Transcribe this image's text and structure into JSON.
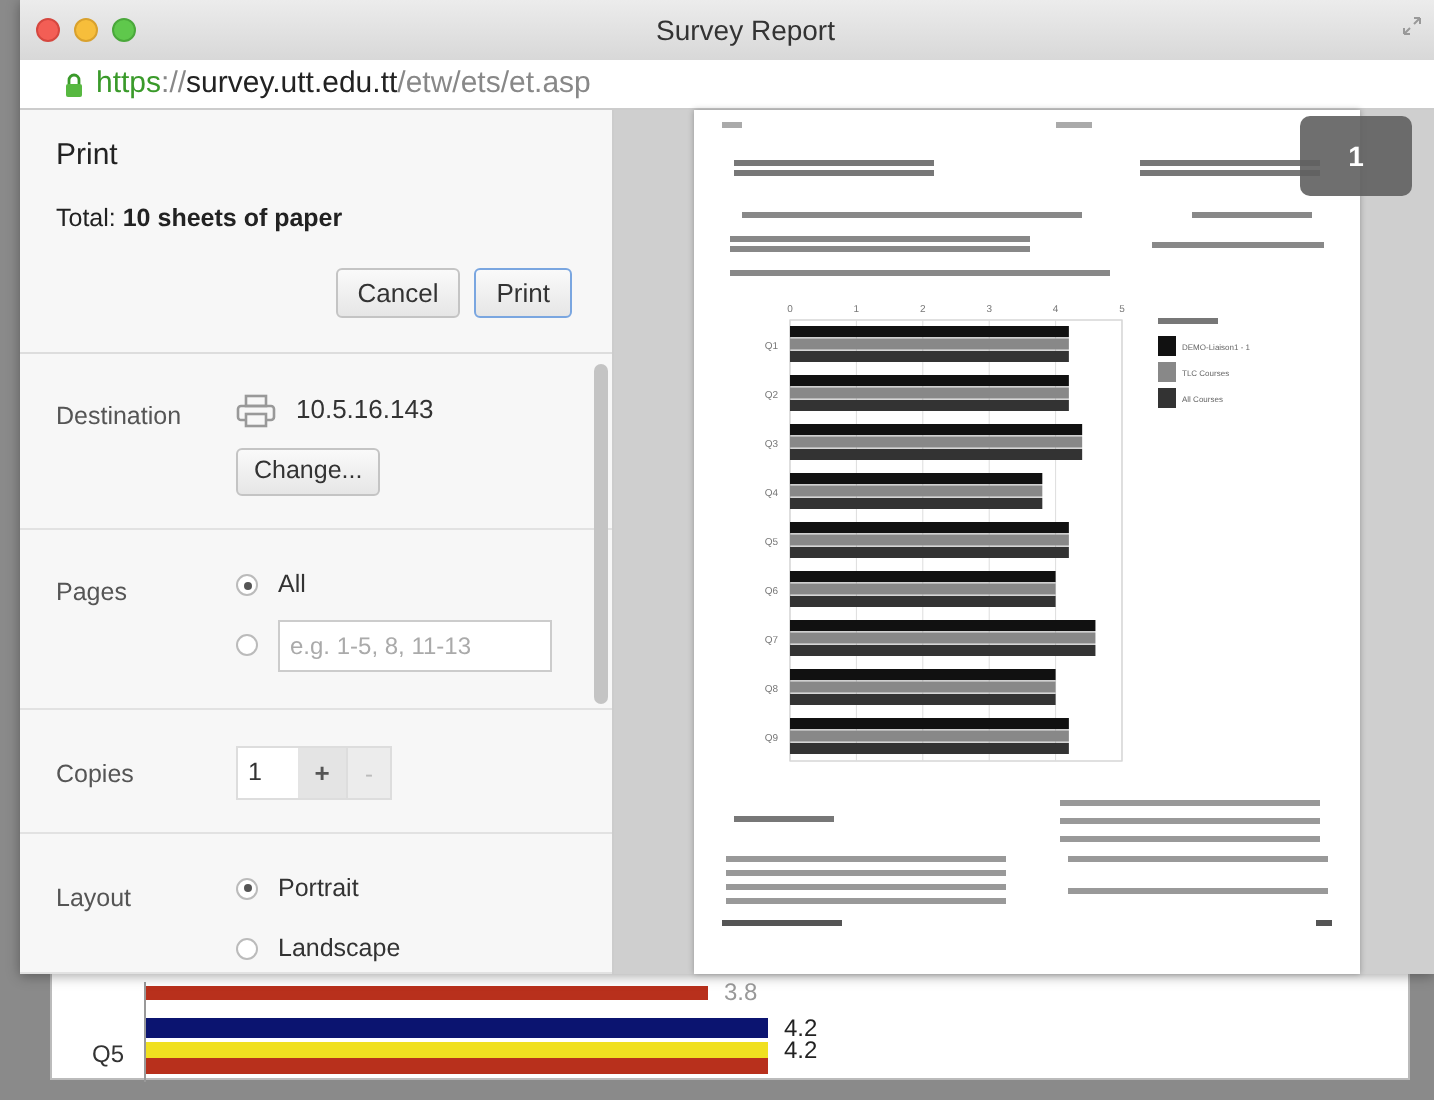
{
  "window": {
    "title": "Survey Report",
    "url": {
      "scheme": "https",
      "separator": "://",
      "host": "survey.utt.edu.tt",
      "path": "/etw/ets/et.asp"
    }
  },
  "print_panel": {
    "title": "Print",
    "total": "Total: **10 sheets of paper**",
    "buttons": [
      {
        "label": "Cancel",
        "default": false
      },
      {
        "label": "Print",
        "default": true
      }
    ]
  },
  "settings": [
    {
      "kind": "destination",
      "label": "Destination",
      "printer": "10.5.16.143",
      "button": "Change..."
    },
    {
      "kind": "pages",
      "label": "Pages",
      "options": [
        {
          "label": "All",
          "selected": true
        },
        {
          "placeholder": "e.g. 1-5, 8, 11-13",
          "selected": false
        }
      ]
    },
    {
      "kind": "copies",
      "label": "Copies",
      "value": "1",
      "increment": "+",
      "decrement": "-",
      "decrement_disabled": true
    },
    {
      "kind": "layout",
      "label": "Layout",
      "options": [
        {
          "label": "Portrait",
          "selected": true
        },
        {
          "label": "Landscape",
          "selected": false
        }
      ]
    }
  ],
  "preview": {
    "page_number": "1",
    "chart_data": {
      "type": "bar",
      "orientation": "horizontal",
      "categories": [
        "Q1",
        "Q2",
        "Q3",
        "Q4",
        "Q5",
        "Q6",
        "Q7",
        "Q8",
        "Q9"
      ],
      "xlim": [
        0,
        5
      ],
      "grid": true,
      "xticks": [
        0,
        1,
        2,
        3,
        4,
        5
      ],
      "series": [
        {
          "name": "DEMO-Liaison1 - 1",
          "color": "#111111",
          "values": [
            4.2,
            4.2,
            4.4,
            3.8,
            4.2,
            4.0,
            4.6,
            4.0,
            4.2
          ]
        },
        {
          "name": "TLC Courses",
          "color": "#888888",
          "values": [
            4.2,
            4.2,
            4.4,
            3.8,
            4.2,
            4.0,
            4.6,
            4.0,
            4.2
          ]
        },
        {
          "name": "All Courses",
          "color": "#333333",
          "values": [
            4.2,
            4.2,
            4.4,
            3.8,
            4.2,
            4.0,
            4.6,
            4.0,
            4.2
          ]
        }
      ]
    }
  },
  "background_chart": {
    "category": "Q5",
    "bars": [
      {
        "value": "3.8",
        "color": "#b8301c",
        "level": 0.76
      },
      {
        "value": "4.2",
        "color": "#0b1470",
        "level": 0.84
      },
      {
        "value": "4.2",
        "color": "#f0e020",
        "level": 0.84
      },
      {
        "color": "#b8301c",
        "level": 0.84
      }
    ]
  }
}
